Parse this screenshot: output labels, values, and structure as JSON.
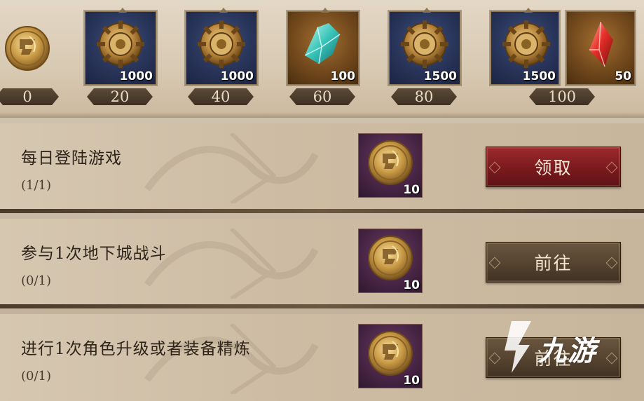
{
  "track": {
    "start": {
      "count": "0",
      "icon": "medal-coin-icon"
    },
    "milestones": [
      {
        "threshold": "20",
        "rewards": [
          {
            "icon": "bronze-wheel-icon",
            "qty": "1000",
            "style": "blue"
          }
        ]
      },
      {
        "threshold": "40",
        "rewards": [
          {
            "icon": "bronze-wheel-icon",
            "qty": "1000",
            "style": "blue"
          }
        ]
      },
      {
        "threshold": "60",
        "rewards": [
          {
            "icon": "teal-crystal-icon",
            "qty": "100",
            "style": "gold"
          }
        ]
      },
      {
        "threshold": "80",
        "rewards": [
          {
            "icon": "bronze-wheel-icon",
            "qty": "1500",
            "style": "blue"
          }
        ]
      },
      {
        "threshold": "100",
        "rewards": [
          {
            "icon": "bronze-wheel-icon",
            "qty": "1500",
            "style": "blue"
          },
          {
            "icon": "red-gem-icon",
            "qty": "50",
            "style": "gold"
          }
        ]
      }
    ]
  },
  "tasks": [
    {
      "title": "每日登陆游戏",
      "progress": "(1/1)",
      "reward_qty": "10",
      "reward_icon": "medal-coin-icon",
      "button": "领取",
      "button_state": "claim"
    },
    {
      "title": "参与1次地下城战斗",
      "progress": "(0/1)",
      "reward_qty": "10",
      "reward_icon": "medal-coin-icon",
      "button": "前往",
      "button_state": "go"
    },
    {
      "title": "进行1次角色升级或者装备精炼",
      "progress": "(0/1)",
      "reward_qty": "10",
      "reward_icon": "medal-coin-icon",
      "button": "前往",
      "button_state": "go"
    }
  ],
  "watermark": {
    "text": "九游"
  },
  "colors": {
    "claim_button": "#7a1a1e",
    "go_button": "#54432f",
    "card_blue": "#283459",
    "card_purple": "#4a2647"
  }
}
